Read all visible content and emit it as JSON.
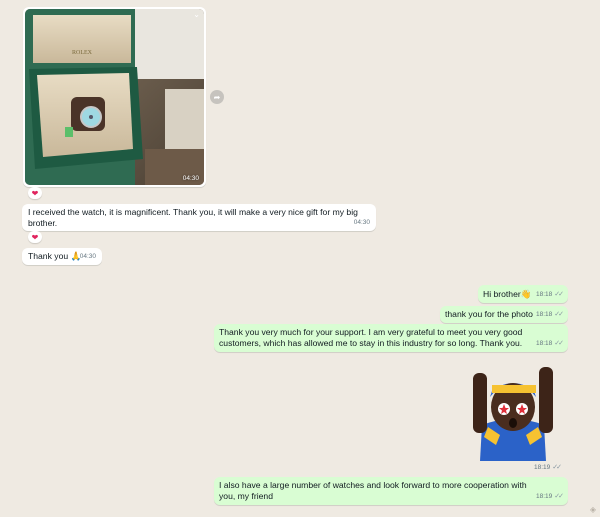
{
  "messages": {
    "photo": {
      "time": "04:30",
      "reaction": "❤"
    },
    "m1": {
      "text": "I received the watch, it is magnificent. Thank you, it will make a very nice gift for my big brother.",
      "time": "04:30",
      "reaction": "❤"
    },
    "m2": {
      "text": "Thank you 🙏",
      "time": "04:30"
    },
    "o1": {
      "text": "Hi brother👋",
      "time": "18:18"
    },
    "o2": {
      "text": "thank you for the photo",
      "time": "18:18"
    },
    "o3": {
      "text": "Thank you very much for your support. I am very grateful to meet you very good customers, which has allowed me to stay in this industry for so long. Thank you.",
      "time": "18:18"
    },
    "sticker": {
      "time": "18:19"
    },
    "o4": {
      "text": "I also have a large number of watches and look forward to more cooperation with you, my friend",
      "time": "18:19"
    }
  },
  "photo_brand": "ROLEX",
  "icons": {
    "forward": "forward-icon",
    "read_receipt": "double-check-icon",
    "chevron": "chevron-down-icon",
    "reaction": "heart-icon"
  },
  "colors": {
    "incoming": "#ffffff",
    "outgoing": "#d9fdd3",
    "background": "#efeae2",
    "meta": "#667781"
  }
}
